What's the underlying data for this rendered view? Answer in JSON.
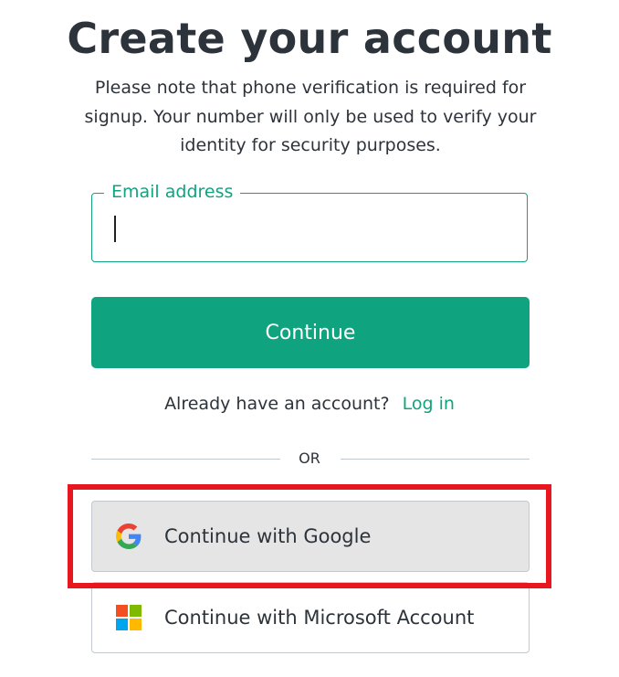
{
  "page": {
    "title": "Create your account",
    "subtitle": "Please note that phone verification is required for signup. Your number will only be used to verify your identity for security purposes."
  },
  "email": {
    "label": "Email address",
    "value": ""
  },
  "continue_button": {
    "label": "Continue"
  },
  "login": {
    "prompt": "Already have an account?",
    "link_label": "Log in"
  },
  "divider": {
    "label": "OR"
  },
  "social": {
    "google": {
      "label": "Continue with Google",
      "icon": "google-icon"
    },
    "microsoft": {
      "label": "Continue with Microsoft Account",
      "icon": "microsoft-icon"
    }
  },
  "colors": {
    "accent": "#10a37f",
    "text": "#2d333a",
    "highlight": "#e8161f",
    "google_button_bg": "#e5e5e5",
    "border": "#c2c8d0"
  }
}
